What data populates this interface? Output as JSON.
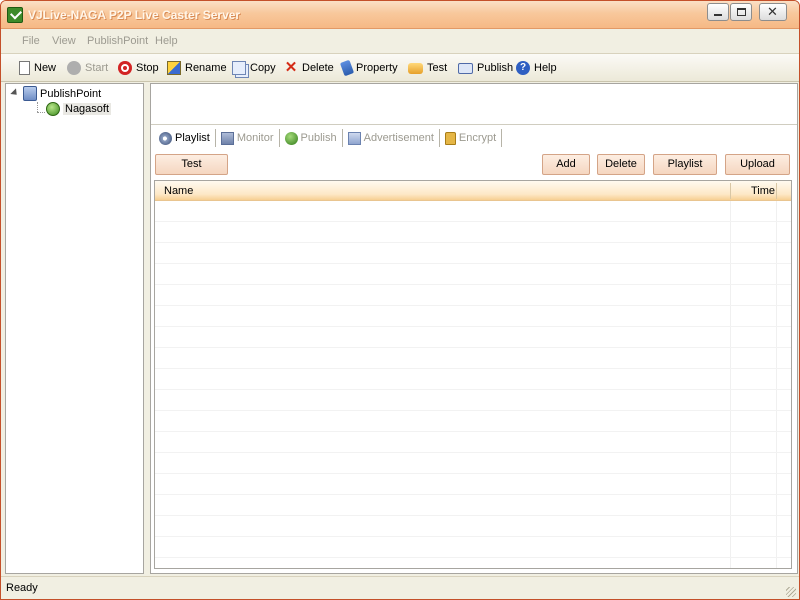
{
  "window": {
    "title": "VJLive-NAGA P2P Live Caster Server"
  },
  "menu": {
    "items": [
      "File",
      "View",
      "PublishPoint",
      "Help"
    ]
  },
  "toolbar": {
    "new": "New",
    "start": "Start",
    "stop": "Stop",
    "rename": "Rename",
    "copy": "Copy",
    "delete": "Delete",
    "property": "Property",
    "test": "Test",
    "publish": "Publish",
    "help": "Help"
  },
  "tree": {
    "root": "PublishPoint",
    "child": "Nagasoft"
  },
  "tabs": [
    "Playlist",
    "Monitor",
    "Publish",
    "Advertisement",
    "Encrypt"
  ],
  "actions": {
    "test": "Test",
    "add": "Add",
    "delete": "Delete",
    "playlist": "Playlist",
    "upload": "Upload"
  },
  "list": {
    "columns": [
      "Name",
      "Time"
    ],
    "rows": []
  },
  "status": {
    "text": "Ready"
  }
}
